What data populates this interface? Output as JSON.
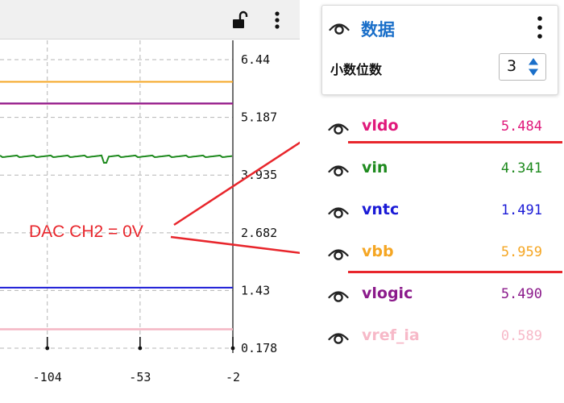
{
  "plot": {
    "y_tick_labels": [
      "6.44",
      "5.187",
      "3.935",
      "2.682",
      "1.43",
      "0.178"
    ],
    "x_tick_labels": [
      "-104",
      "-53",
      "-2"
    ],
    "annotation": "DAC CH2 = 0V"
  },
  "chart_data": {
    "type": "line",
    "x": [
      -130,
      -104,
      -53,
      -2
    ],
    "xlim": [
      -130,
      -2
    ],
    "ylim": [
      0.178,
      6.44
    ],
    "y_ticks": [
      6.44,
      5.187,
      3.935,
      2.682,
      1.43,
      0.178
    ],
    "x_ticks": [
      -104,
      -53,
      -2
    ],
    "grid": true,
    "series": [
      {
        "name": "vbb",
        "color": "#f5a623",
        "values": [
          5.959,
          5.959,
          5.959,
          5.959
        ]
      },
      {
        "name": "vldo",
        "color": "#d6197a",
        "values": [
          5.484,
          5.484,
          5.484,
          5.484
        ]
      },
      {
        "name": "vlogic",
        "color": "#8b1a8b",
        "values": [
          5.49,
          5.49,
          5.49,
          5.49
        ]
      },
      {
        "name": "vin",
        "color": "#1e8a1e",
        "values": [
          4.341,
          4.341,
          4.341,
          4.341
        ]
      },
      {
        "name": "vntc",
        "color": "#1a1ad6",
        "values": [
          1.491,
          1.491,
          1.491,
          1.491
        ]
      },
      {
        "name": "vref_ia",
        "color": "#f4b6c4",
        "values": [
          0.589,
          0.589,
          0.589,
          0.589
        ]
      }
    ]
  },
  "panel": {
    "title": "数据",
    "decimals_label": "小数位数",
    "decimals_value": "3"
  },
  "signals": [
    {
      "name": "vldo",
      "value": "5.484",
      "color": "#e0197b"
    },
    {
      "name": "vin",
      "value": "4.341",
      "color": "#1e8a1e"
    },
    {
      "name": "vntc",
      "value": "1.491",
      "color": "#1a1ad6"
    },
    {
      "name": "vbb",
      "value": "5.959",
      "color": "#f5a623"
    },
    {
      "name": "vlogic",
      "value": "5.490",
      "color": "#8b1a8b"
    },
    {
      "name": "vref_ia",
      "value": "0.589",
      "color": "#f7b9c8"
    }
  ],
  "colors": {
    "annotation": "#e8262c",
    "grid": "#b5b5b5",
    "title_blue": "#1a6fc9",
    "stepper_blue": "#1a6fc9"
  }
}
